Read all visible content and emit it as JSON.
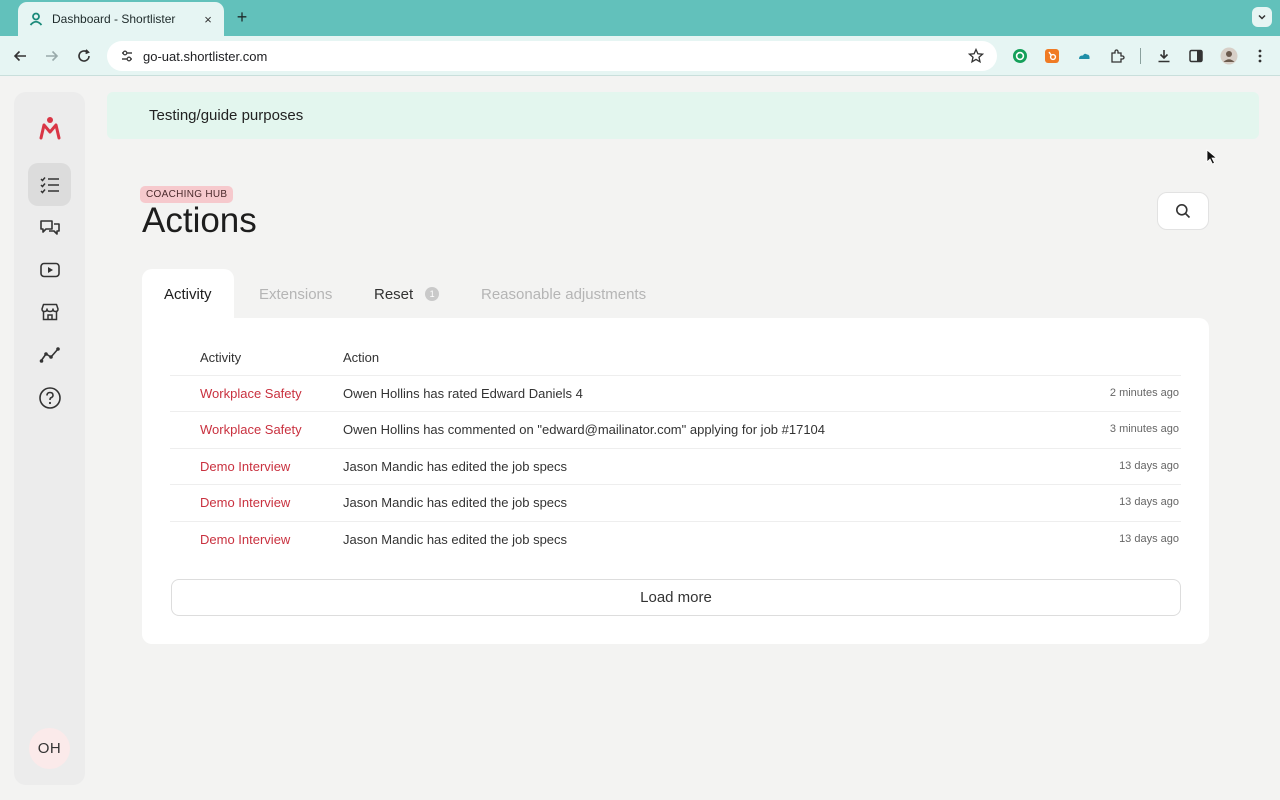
{
  "browser": {
    "tab_title": "Dashboard - Shortlister",
    "url": "go-uat.shortlister.com",
    "new_tab": "+",
    "close": "×"
  },
  "banner": {
    "text": "Testing/guide purposes"
  },
  "header": {
    "eyebrow": "COACHING HUB",
    "title": "Actions"
  },
  "tabs": [
    {
      "label": "Activity",
      "state": "active"
    },
    {
      "label": "Extensions",
      "state": "muted"
    },
    {
      "label": "Reset",
      "state": "normal",
      "badge": "1"
    },
    {
      "label": "Reasonable adjustments",
      "state": "muted"
    }
  ],
  "table": {
    "columns": [
      "Activity",
      "Action"
    ],
    "rows": [
      {
        "activity": "Workplace Safety",
        "action": "Owen Hollins has rated Edward Daniels 4",
        "time": "2 minutes ago"
      },
      {
        "activity": "Workplace Safety",
        "action": "Owen Hollins has commented on \"edward@mailinator.com\" applying for job #17104",
        "time": "3 minutes ago"
      },
      {
        "activity": "Demo Interview",
        "action": "Jason Mandic has edited the job specs",
        "time": "13 days ago"
      },
      {
        "activity": "Demo Interview",
        "action": "Jason Mandic has edited the job specs",
        "time": "13 days ago"
      },
      {
        "activity": "Demo Interview",
        "action": "Jason Mandic has edited the job specs",
        "time": "13 days ago"
      }
    ],
    "load_more": "Load more"
  },
  "sidebar": {
    "items": [
      {
        "icon": "checklist-icon",
        "active": true
      },
      {
        "icon": "chat-bubbles-icon",
        "active": false
      },
      {
        "icon": "video-play-icon",
        "active": false
      },
      {
        "icon": "storefront-icon",
        "active": false
      },
      {
        "icon": "trend-line-icon",
        "active": false
      },
      {
        "icon": "help-circle-icon",
        "active": false
      }
    ],
    "avatar_initials": "OH"
  },
  "colors": {
    "tabstrip": "#62c1bb",
    "toolbar": "#e6f5f3",
    "accent_red": "#c9313f",
    "banner": "#e3f6ee",
    "eyebrow_bg": "#f6c9cd"
  }
}
